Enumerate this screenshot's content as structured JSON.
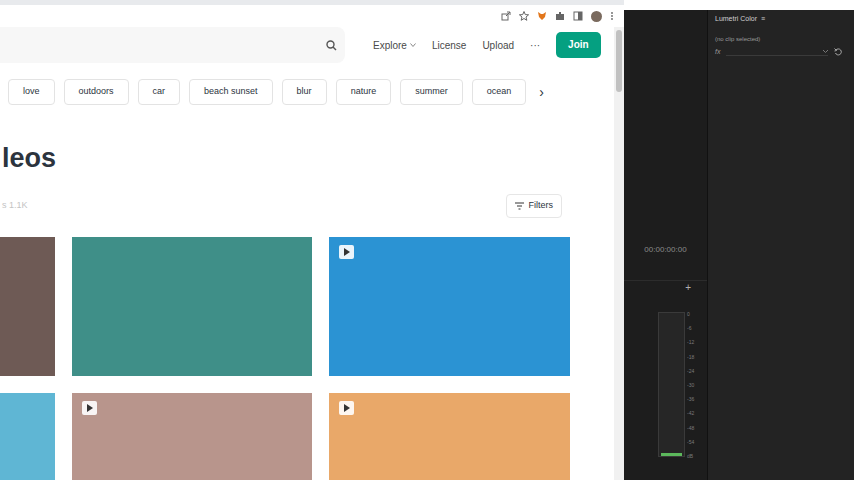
{
  "nav": [
    {
      "label": "Explore",
      "kind": "dropdown"
    },
    {
      "label": "License",
      "kind": "link"
    },
    {
      "label": "Upload",
      "kind": "link"
    },
    {
      "label": "···",
      "kind": "more"
    },
    {
      "label": "Join",
      "kind": "button"
    }
  ],
  "tags": [
    "love",
    "outdoors",
    "car",
    "beach sunset",
    "blur",
    "nature",
    "summer",
    "ocean"
  ],
  "tags_next": "›",
  "heading": "leos",
  "count": "s 1.1K",
  "filters": "Filters",
  "media": [
    {
      "kind": "photo",
      "color": "#6e5a55"
    },
    {
      "kind": "photo",
      "color": "#3f8f88"
    },
    {
      "kind": "video",
      "color": "#2b93d3"
    },
    {
      "kind": "photo",
      "color": "#5fb6d4"
    },
    {
      "kind": "video",
      "color": "#b8958c"
    },
    {
      "kind": "video",
      "color": "#e9a869"
    }
  ],
  "premiere": {
    "timecode": "00:00:00:00",
    "add": "+",
    "meter": {
      "labels": [
        "0",
        "-6",
        "-12",
        "-18",
        "-24",
        "-30",
        "-36",
        "-42",
        "-48",
        "-54",
        "dB"
      ],
      "level": 0.02
    },
    "lumetri": {
      "title": "Lumetri Color",
      "menu": "≡",
      "status": "(no clip selected)",
      "fx": "fx"
    }
  }
}
